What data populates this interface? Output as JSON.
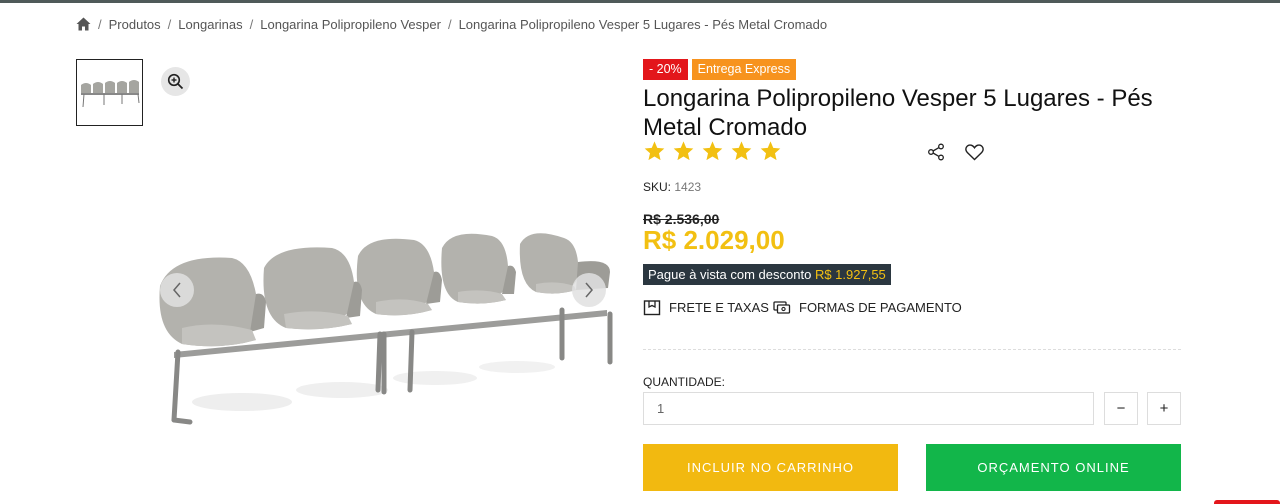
{
  "breadcrumb": {
    "icon": "home-icon",
    "items": [
      "Produtos",
      "Longarinas",
      "Longarina Polipropileno Vesper",
      "Longarina Polipropileno Vesper 5 Lugares - Pés Metal Cromado"
    ],
    "separator": "/"
  },
  "gallery": {
    "thumbnail_icon": "product-thumbnail",
    "zoom_icon": "zoom-in-icon",
    "prev_icon": "chevron-left-icon",
    "next_icon": "chevron-right-icon"
  },
  "product": {
    "badges": {
      "discount": "- 20%",
      "express": "Entrega Express"
    },
    "title": "Longarina Polipropileno Vesper 5 Lugares - Pés Metal Cromado",
    "rating": {
      "value": 5,
      "max": 5
    },
    "sku_label": "SKU:",
    "sku_value": "1423",
    "old_price": "R$ 2.536,00",
    "price": "R$ 2.029,00",
    "cash_label": "Pague à vista com desconto",
    "cash_price": "R$ 1.927,55",
    "freight_label": "FRETE E TAXAS",
    "payment_label": "FORMAS DE PAGAMENTO",
    "quantity_label": "QUANTIDADE:",
    "quantity_value": "1",
    "minus_label": "−",
    "plus_label": "+",
    "add_to_cart": "INCLUIR NO CARRINHO",
    "online_quote": "ORÇAMENTO ONLINE"
  },
  "colors": {
    "star": "#f2c012",
    "price": "#f2c012",
    "badge_discount": "#e3161b",
    "badge_express": "#f7931e",
    "cart_button": "#f2b910",
    "quote_button": "#12b64a",
    "cash_box": "#2b3740"
  }
}
